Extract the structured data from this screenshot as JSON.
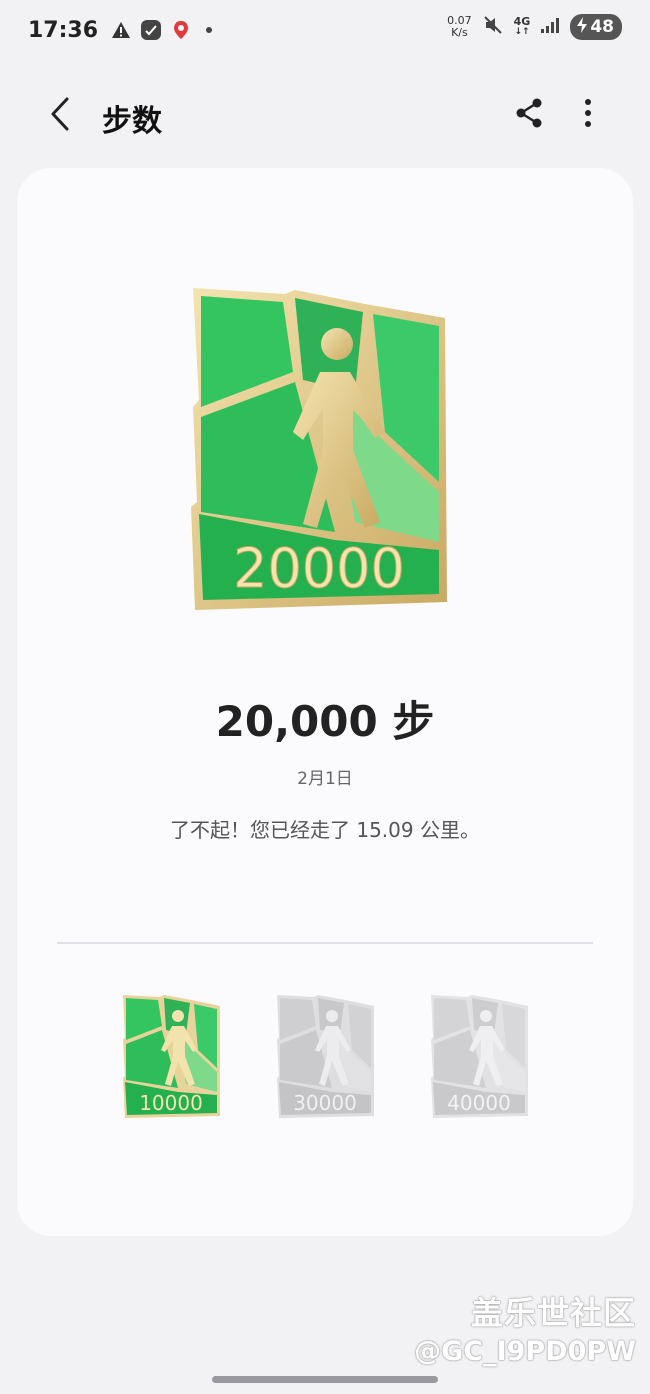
{
  "status_bar": {
    "time": "17:36",
    "speed_value": "0.07",
    "speed_unit": "K/s",
    "network": "4G",
    "battery": "48",
    "icons": [
      "warning-icon",
      "app-badge-icon",
      "map-pin-icon",
      "mute-icon",
      "signal-icon",
      "charging-icon"
    ]
  },
  "header": {
    "title": "步数",
    "back_icon": "chevron-left-icon",
    "share_icon": "share-icon",
    "more_icon": "more-vertical-icon"
  },
  "achievement": {
    "badge_number": "20000",
    "steps_label": "20,000 步",
    "date": "2月1日",
    "message": "了不起！您已经走了 15.09 公里。"
  },
  "other_badges": [
    {
      "number": "10000",
      "earned": true
    },
    {
      "number": "30000",
      "earned": false
    },
    {
      "number": "40000",
      "earned": false
    }
  ],
  "watermark": {
    "line1": "盖乐世社区",
    "line2": "@GC_I9PD0PW"
  },
  "colors": {
    "background": "#f2f2f5",
    "card": "#fbfbfd",
    "badge_green": "#2fbd5c",
    "badge_light_green": "#7ed98a",
    "badge_gold": "#e8d49a",
    "locked_gray": "#d6d6d8"
  }
}
